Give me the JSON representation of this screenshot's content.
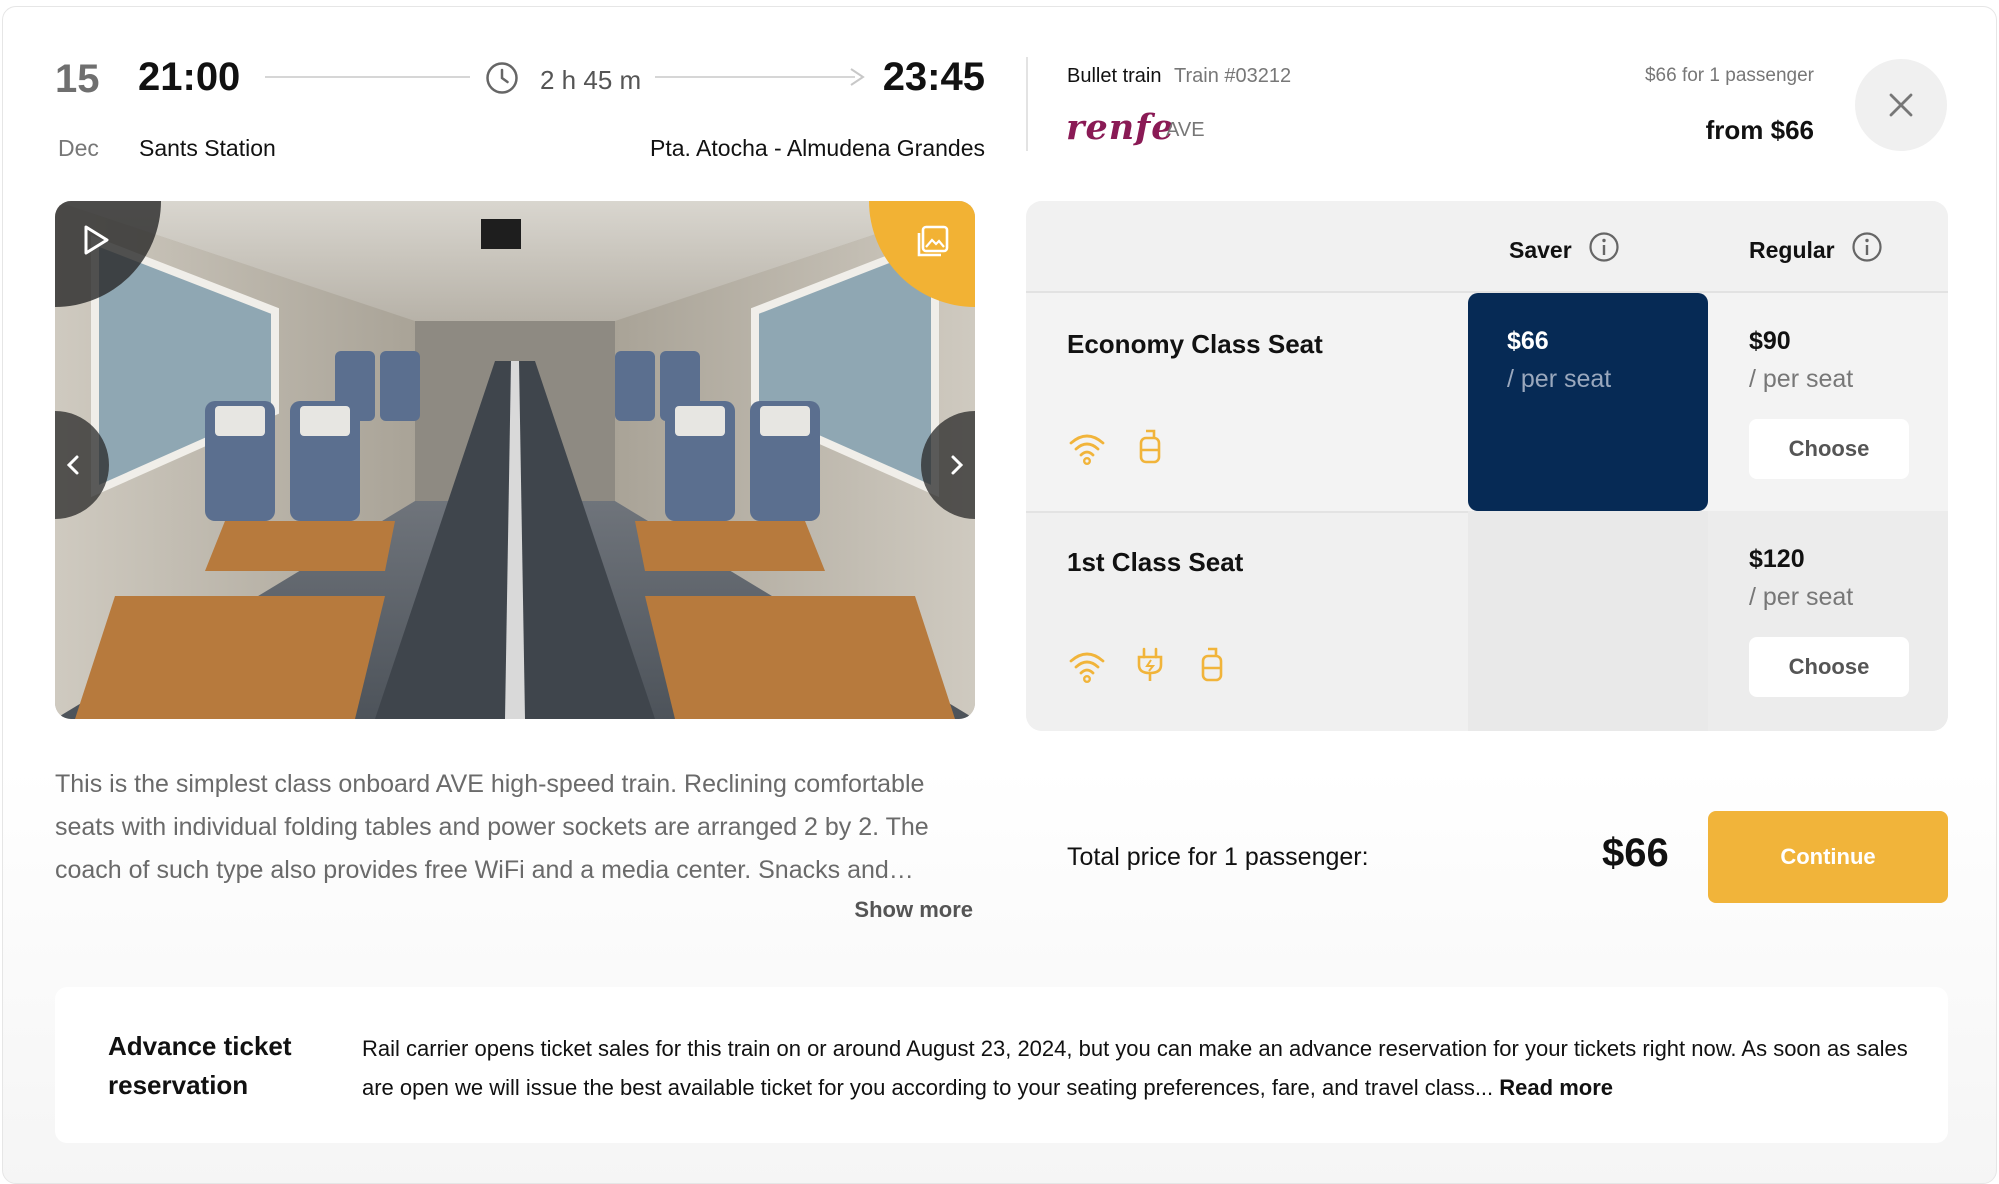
{
  "journey": {
    "day": "15",
    "month": "Dec",
    "departure_time": "21:00",
    "departure_station": "Sants Station",
    "duration": "2 h 45 m",
    "arrival_time": "23:45",
    "arrival_station": "Pta. Atocha - Almudena Grandes"
  },
  "train": {
    "type": "Bullet train",
    "number": "Train #03212",
    "operator_logo": "renfe",
    "service": "AVE",
    "price_for_passengers": "$66 for 1 passenger",
    "from_price": "from $66"
  },
  "icons": {
    "close": "close-icon",
    "clock": "clock-icon",
    "play": "play-icon",
    "gallery": "gallery-icon",
    "prev": "chevron-left-icon",
    "next": "chevron-right-icon",
    "info": "info-icon",
    "wifi": "wifi-icon",
    "power": "power-plug-icon",
    "luggage": "luggage-icon"
  },
  "description": {
    "text": "This is the simplest class onboard AVE high-speed train. Reclining comfortable seats with individual folding tables and power sockets are arranged 2 by 2. The coach of such type also provides free WiFi and a media center. Snacks and…",
    "show_more": "Show more"
  },
  "fares": {
    "columns": [
      "Saver",
      "Regular"
    ],
    "rows": [
      {
        "name": "Economy Class Seat",
        "amenities": [
          "wifi-icon",
          "luggage-icon"
        ],
        "saver": {
          "price": "$66",
          "per": "/ per seat",
          "selected": true
        },
        "regular": {
          "price": "$90",
          "per": "/ per seat",
          "action": "Choose"
        }
      },
      {
        "name": "1st Class Seat",
        "amenities": [
          "wifi-icon",
          "power-plug-icon",
          "luggage-icon"
        ],
        "saver": null,
        "regular": {
          "price": "$120",
          "per": "/ per seat",
          "action": "Choose"
        }
      }
    ]
  },
  "total": {
    "label": "Total price for 1 passenger:",
    "price": "$66",
    "continue": "Continue"
  },
  "notice": {
    "title": "Advance ticket reservation",
    "text": "Rail carrier opens ticket sales for this train on or around August 23, 2024, but you can make an advance reservation for your tickets right now. As soon as sales are open we will issue the best available ticket for you according to your seating preferences, fare, and travel class...",
    "read_more": "Read more"
  },
  "colors": {
    "accent": "#f1b43a",
    "selected_fare": "#062a55",
    "brand": "#8a1a55",
    "amenity_icon": "#f1b43a"
  }
}
